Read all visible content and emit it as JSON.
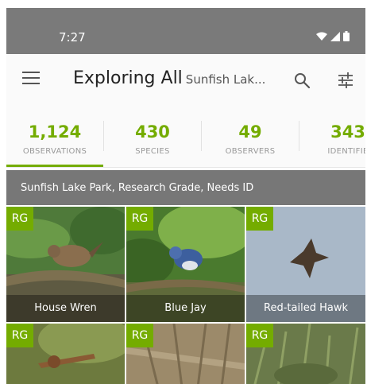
{
  "status_bar": {
    "time": "7:27"
  },
  "app_bar": {
    "title": "Exploring All",
    "subtitle": "Sunfish Lak..."
  },
  "stats": [
    {
      "value": "1,124",
      "label": "OBSERVATIONS"
    },
    {
      "value": "430",
      "label": "SPECIES"
    },
    {
      "value": "49",
      "label": "OBSERVERS"
    },
    {
      "value": "343",
      "label": "IDENTIFIE"
    }
  ],
  "filter_banner": {
    "text": "Sunfish Lake Park, Research Grade, Needs ID"
  },
  "observations": [
    {
      "badge": "RG",
      "name": "House Wren"
    },
    {
      "badge": "RG",
      "name": "Blue Jay"
    },
    {
      "badge": "RG",
      "name": "Red-tailed Hawk"
    },
    {
      "badge": "RG",
      "name": ""
    },
    {
      "badge": "RG",
      "name": ""
    },
    {
      "badge": "RG",
      "name": ""
    }
  ],
  "colors": {
    "accent": "#74ac00",
    "status_bar": "#7a7a7a",
    "banner": "#777777"
  },
  "icons": [
    "menu-icon",
    "search-icon",
    "filter-sliders-icon",
    "wifi-icon",
    "signal-icon",
    "battery-icon"
  ]
}
